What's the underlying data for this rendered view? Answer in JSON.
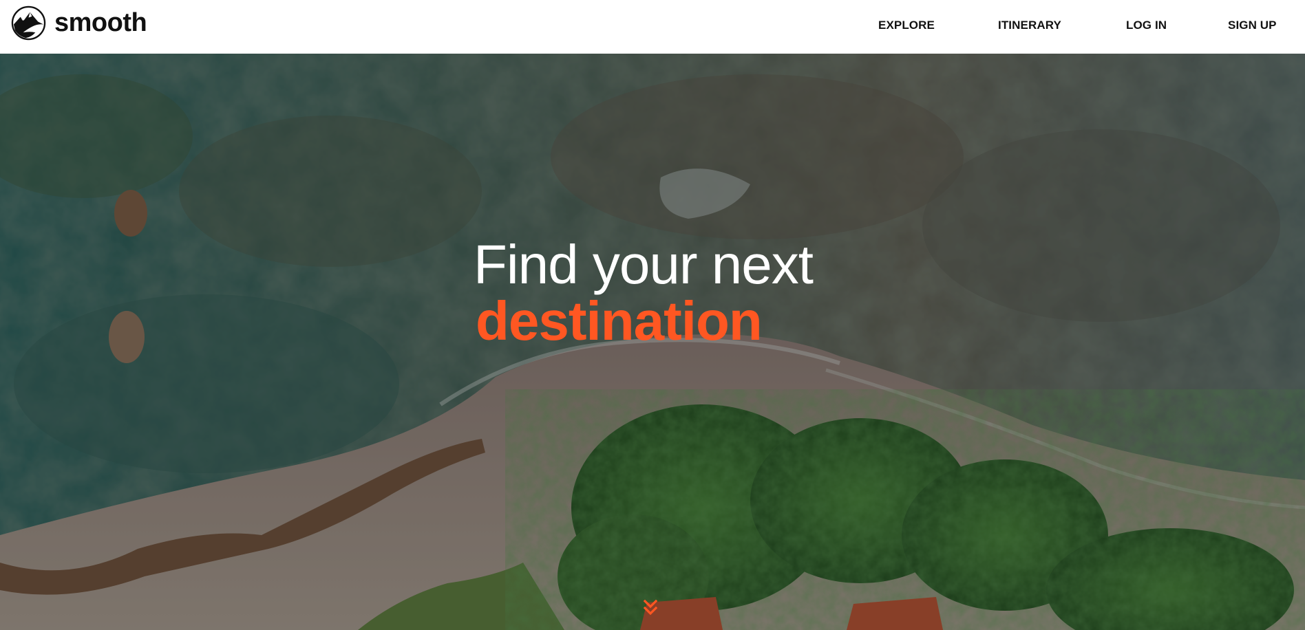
{
  "brand": {
    "name": "smooth",
    "logo_icon": "mountain-circle-logo-icon"
  },
  "nav": {
    "explore": "EXPLORE",
    "itinerary": "ITINERARY",
    "login": "LOG IN",
    "signup": "SIGN UP"
  },
  "hero": {
    "headline_line1": "Find your next",
    "headline_line2": "destination",
    "background": "aerial-coastline-beach-trees-image",
    "scroll_icon": "double-chevron-down-icon"
  },
  "colors": {
    "accent": "#ff5722",
    "header_bg": "#ffffff",
    "text_dark": "#111111",
    "headline_white": "#ffffff"
  }
}
